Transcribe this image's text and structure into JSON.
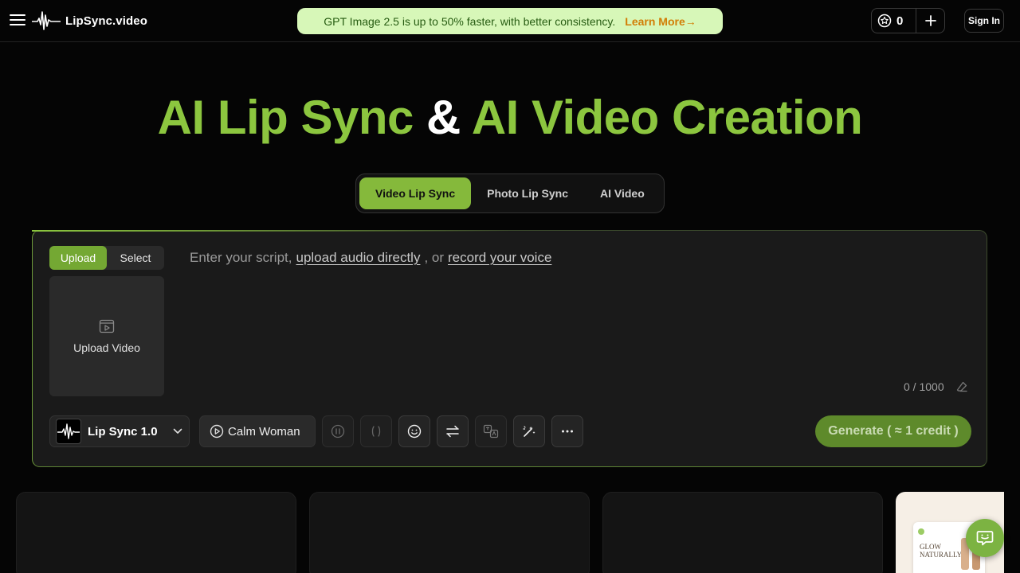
{
  "header": {
    "logo_text": "LipSync.video",
    "promo_text": "GPT Image 2.5 is up to 50% faster, with better consistency.",
    "promo_link": "Learn More→",
    "credits_count": "0",
    "signin_label": "Sign In"
  },
  "hero": {
    "part1": "AI Lip Sync",
    "part2": "&",
    "part3": "AI Video Creation"
  },
  "tabs": [
    "Video Lip Sync",
    "Photo Lip Sync",
    "AI Video"
  ],
  "editor": {
    "upload_tab": "Upload",
    "select_tab": "Select",
    "upload_video_label": "Upload Video",
    "script_prefix": "Enter your script,",
    "script_link1": "upload audio directly",
    "script_mid": ", or",
    "script_link2": "record your voice",
    "counter": "0 / 1000",
    "model_label": "Lip Sync 1.0",
    "voice_label": "Calm Woman",
    "generate_label": "Generate ( ≈ 1 credit )"
  },
  "thumb4": {
    "headline": "GLOW",
    "subhead": "NATURALLY"
  },
  "colors": {
    "accent": "#8cc63f",
    "promo_bg": "#d7f7b8",
    "promo_link": "#d27d05",
    "generate_bg": "#5e8a2b"
  }
}
